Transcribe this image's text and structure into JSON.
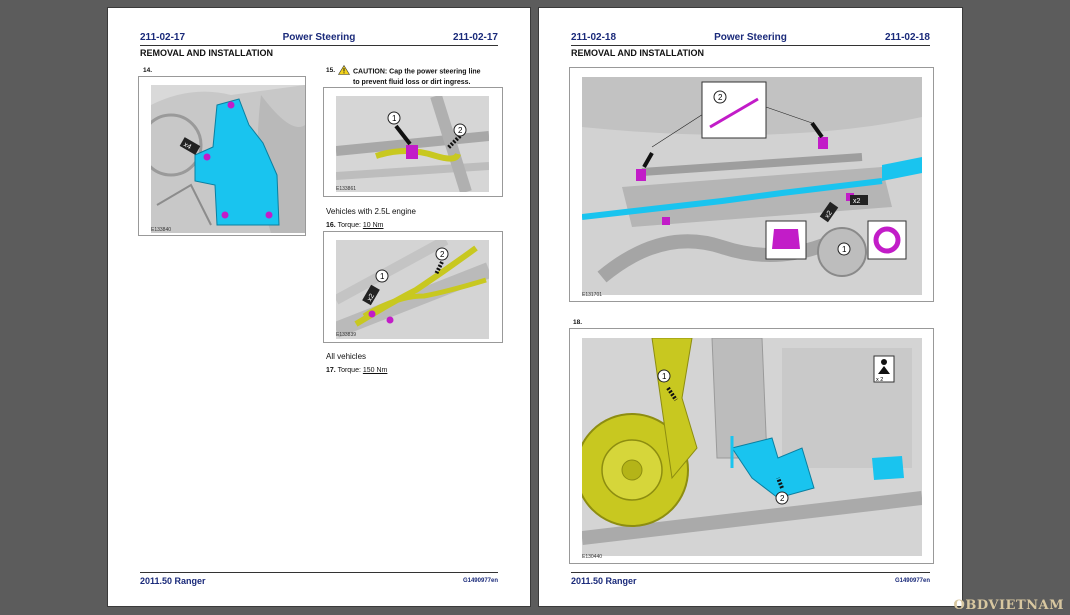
{
  "left_page": {
    "header": {
      "code_left": "211-02-17",
      "title": "Power Steering",
      "code_right": "211-02-17"
    },
    "section": "REMOVAL AND INSTALLATION",
    "step14": {
      "num": "14.",
      "figure_id": "E133840",
      "figure_callout": "x4"
    },
    "step15": {
      "num": "15.",
      "caution_line1": "CAUTION: Cap the power steering line",
      "caution_line2": "to prevent fluid loss or dirt ingress.",
      "figure_id": "E133861",
      "callouts": [
        "1",
        "2"
      ]
    },
    "variant_engine": "Vehicles with 2.5L engine",
    "step16": {
      "num": "16.",
      "label": "Torque:",
      "value": "10 Nm",
      "figure_id": "E133839",
      "callouts": [
        "1",
        "2"
      ],
      "figure_callout": "x2"
    },
    "variant_all": "All vehicles",
    "step17": {
      "num": "17.",
      "label": "Torque:",
      "value": "150 Nm"
    },
    "footer": {
      "model": "2011.50 Ranger",
      "code": "G1490977en"
    }
  },
  "right_page": {
    "header": {
      "code_left": "211-02-18",
      "title": "Power Steering",
      "code_right": "211-02-18"
    },
    "section": "REMOVAL AND INSTALLATION",
    "figure_top": {
      "figure_id": "E131701",
      "callouts": [
        "2",
        "1"
      ],
      "badges": [
        "x2",
        "x2"
      ]
    },
    "step18": {
      "num": "18.",
      "figure_id": "E130440",
      "callouts": [
        "1",
        "2"
      ],
      "badge": "x 2"
    },
    "footer": {
      "model": "2011.50 Ranger",
      "code": "G1490977en"
    }
  },
  "watermark": "OBDVIETNAM",
  "colors": {
    "header_blue": "#1a2a7a",
    "cyan": "#19c4ef",
    "magenta": "#c21cc8",
    "yellow": "#c8c820"
  }
}
